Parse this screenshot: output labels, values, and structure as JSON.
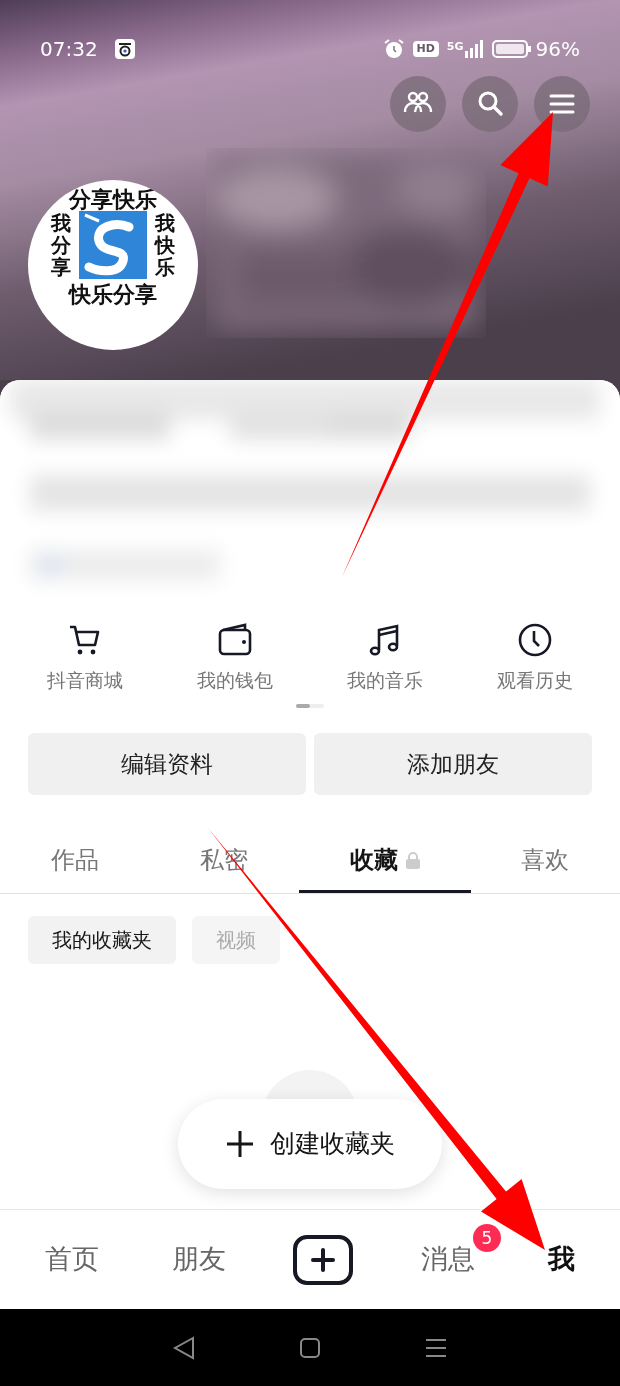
{
  "status_bar": {
    "time": "07:32",
    "hd": "HD",
    "network": "5G",
    "battery": "96%"
  },
  "header_actions": [
    {
      "kind": "friends"
    },
    {
      "kind": "search"
    },
    {
      "kind": "menu"
    }
  ],
  "avatar": {
    "top": "分享快乐",
    "left": "我分享",
    "right": "我快乐",
    "bottom": "快乐分享"
  },
  "shortcuts": [
    {
      "label": "抖音商城",
      "kind": "cart"
    },
    {
      "label": "我的钱包",
      "kind": "wallet"
    },
    {
      "label": "我的音乐",
      "kind": "music"
    },
    {
      "label": "观看历史",
      "kind": "clock"
    }
  ],
  "profile_buttons": [
    "编辑资料",
    "添加朋友"
  ],
  "tabs": [
    {
      "label": "作品",
      "selected": false,
      "locked": false
    },
    {
      "label": "私密",
      "selected": false,
      "locked": false
    },
    {
      "label": "收藏",
      "selected": true,
      "locked": true
    },
    {
      "label": "喜欢",
      "selected": false,
      "locked": false
    }
  ],
  "chips": [
    {
      "label": "我的收藏夹",
      "selected": true
    },
    {
      "label": "视频",
      "selected": false
    }
  ],
  "create_button": {
    "label": "创建收藏夹"
  },
  "bottom_nav": [
    {
      "kind": "tab",
      "label": "首页",
      "selected": false
    },
    {
      "kind": "tab",
      "label": "朋友",
      "selected": false
    },
    {
      "kind": "add"
    },
    {
      "kind": "tab",
      "label": "消息",
      "selected": false,
      "badge": "5"
    },
    {
      "kind": "tab",
      "label": "我",
      "selected": true
    }
  ],
  "annotation_arrows": [
    {
      "kind": "up"
    },
    {
      "kind": "down"
    }
  ]
}
